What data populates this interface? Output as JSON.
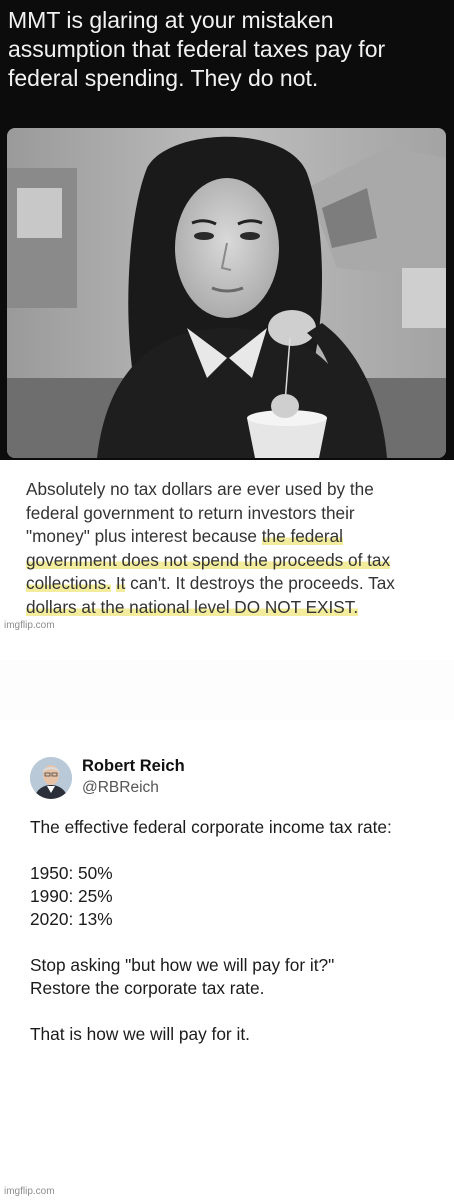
{
  "meme": {
    "caption": "MMT is glaring at your mistaken assumption that federal taxes pay for federal spending. They do not."
  },
  "quote": {
    "part1": "Absolutely no tax dollars are ever used by the federal government to return investors their \"money\" plus interest because ",
    "highlight1": "the federal government does not spend the proceeds of tax collections.",
    "part2": " ",
    "highlight2": "It",
    "part3": " can't. It destroys the proceeds. Tax ",
    "highlight3": "dollars at the national level DO NOT EXIST.",
    "watermark": "imgflip.com"
  },
  "tweet": {
    "author_name": "Robert Reich",
    "author_handle": "@RBReich",
    "lines": [
      "The effective federal corporate income tax rate:",
      "",
      "1950: 50%",
      "1990: 25%",
      "2020: 13%",
      "",
      "Stop asking \"but how we will pay for it?\"",
      "Restore the corporate tax rate.",
      "",
      "That is how we will pay for it."
    ]
  },
  "footer": {
    "watermark": "imgflip.com"
  }
}
